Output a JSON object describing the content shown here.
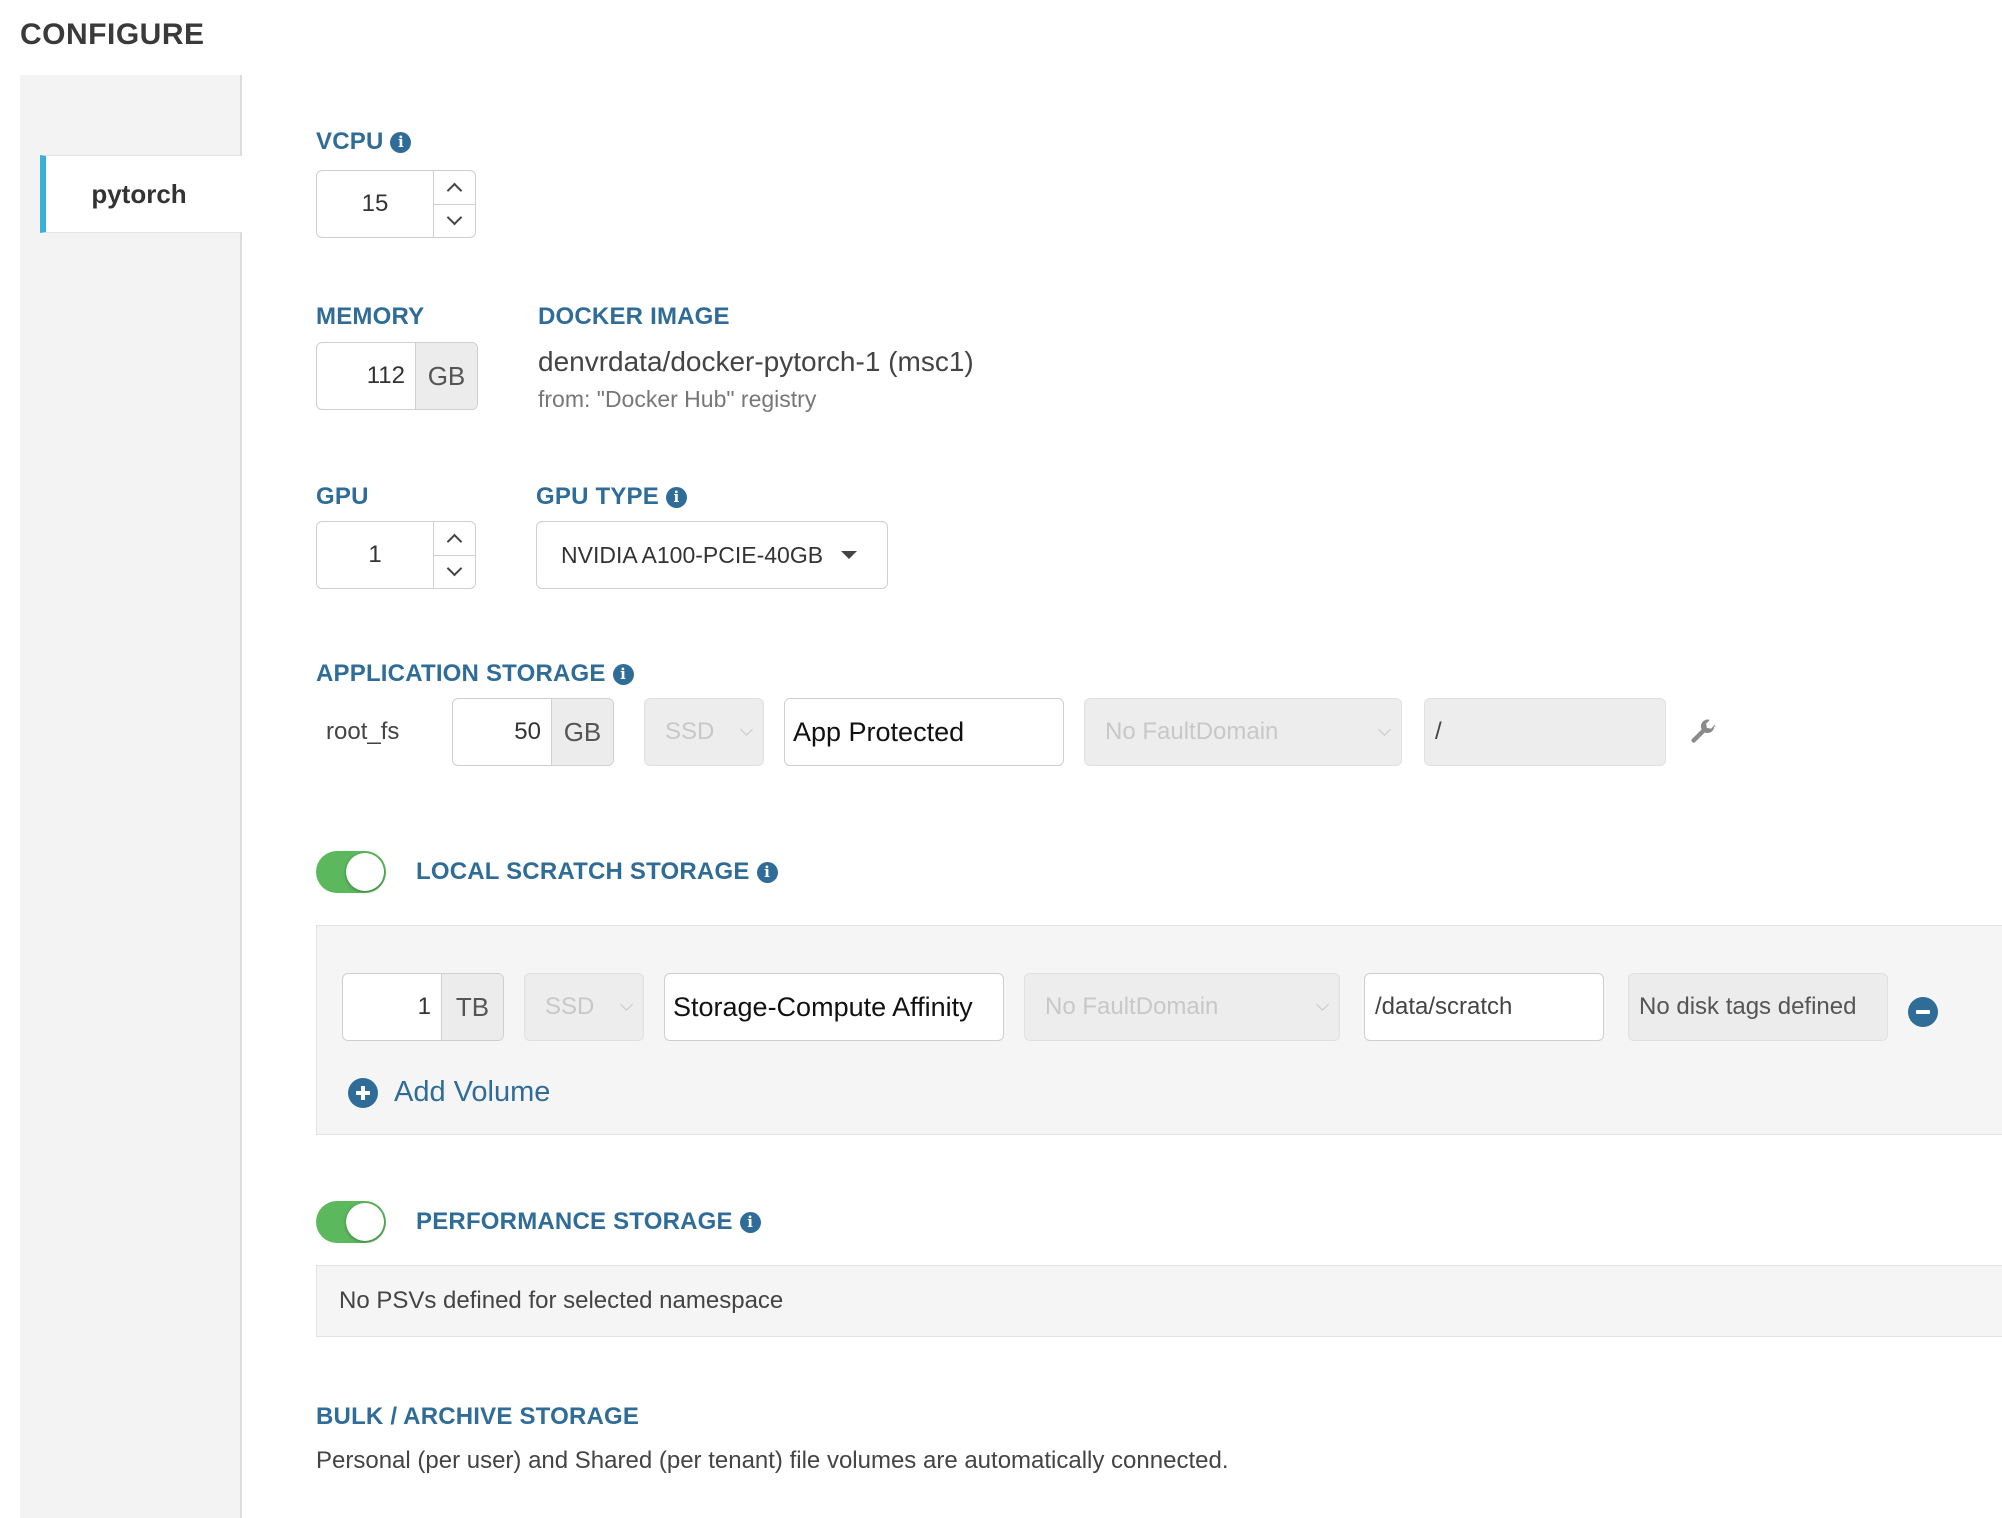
{
  "page": {
    "title": "CONFIGURE"
  },
  "sidebar": {
    "tabs": [
      {
        "label": "pytorch",
        "active": true
      }
    ]
  },
  "vcpu": {
    "label": "VCPU",
    "value": "15"
  },
  "memory": {
    "label": "MEMORY",
    "value": "112",
    "unit": "GB"
  },
  "docker_image": {
    "label": "DOCKER IMAGE",
    "name": "denvrdata/docker-pytorch-1 (msc1)",
    "source": "from: \"Docker Hub\" registry"
  },
  "gpu": {
    "label": "GPU",
    "value": "1"
  },
  "gpu_type": {
    "label": "GPU TYPE",
    "selected": "NVIDIA A100-PCIE-40GB"
  },
  "application_storage": {
    "label": "APPLICATION STORAGE",
    "name": "root_fs",
    "size": "50",
    "unit": "GB",
    "media": "SSD",
    "protection": "App Protected",
    "fault_domain": "No FaultDomain",
    "mount_path": "/"
  },
  "local_scratch": {
    "label": "LOCAL SCRATCH STORAGE",
    "enabled": true,
    "volume": {
      "size": "1",
      "unit": "TB",
      "media": "SSD",
      "affinity": "Storage-Compute Affinity",
      "fault_domain": "No FaultDomain",
      "mount_path": "/data/scratch",
      "disk_tags": "No disk tags defined"
    },
    "add_volume_label": "Add Volume"
  },
  "performance_storage": {
    "label": "PERFORMANCE STORAGE",
    "enabled": true,
    "message": "No PSVs defined for selected namespace"
  },
  "bulk_storage": {
    "label": "BULK / ARCHIVE STORAGE",
    "description": "Personal (per user) and Shared (per tenant) file volumes are automatically connected."
  },
  "colors": {
    "accent": "#2f6c98",
    "toggle_on": "#5cb85c",
    "active_tab_border": "#3ab0d8"
  },
  "icons": {
    "info": "info-circle-icon",
    "settings": "wrench-icon",
    "remove": "minus-circle-icon",
    "add": "plus-circle-icon"
  }
}
